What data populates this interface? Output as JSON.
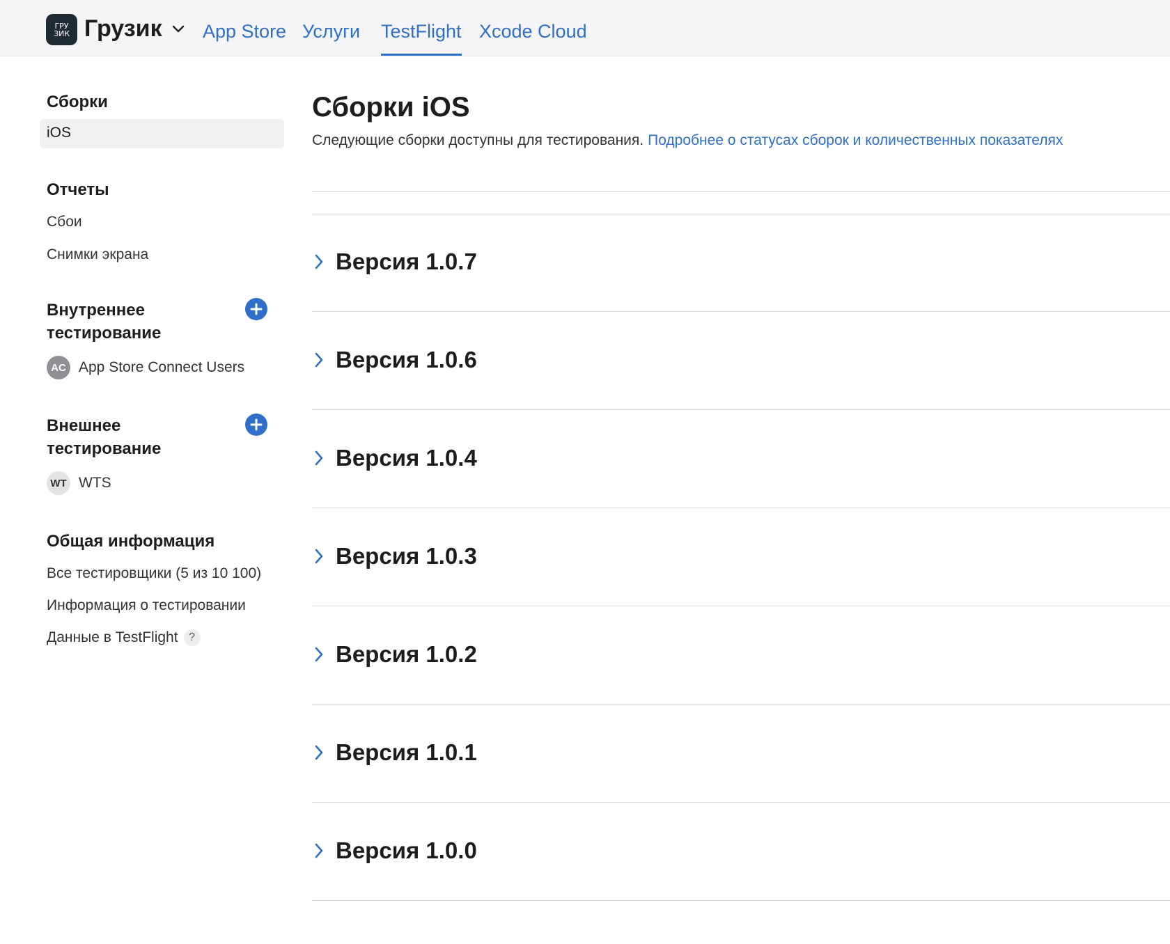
{
  "topbar": {
    "app_icon_text": "ГРУ-ЗИК",
    "app_name": "Грузик",
    "tabs": [
      {
        "label": "App Store"
      },
      {
        "label": "Услуги"
      },
      {
        "label": "TestFlight",
        "active": true
      },
      {
        "label": "Xcode Cloud"
      }
    ]
  },
  "sidebar": {
    "builds": {
      "heading": "Сборки",
      "items": [
        {
          "label": "iOS",
          "selected": true
        }
      ]
    },
    "reports": {
      "heading": "Отчеты",
      "items": [
        {
          "label": "Сбои"
        },
        {
          "label": "Снимки экрана"
        }
      ]
    },
    "internal": {
      "heading": "Внутреннее тестирование",
      "groups": [
        {
          "initials": "AC",
          "label": "App Store Connect Users"
        }
      ]
    },
    "external": {
      "heading": "Внешнее тестирование",
      "groups": [
        {
          "initials": "WT",
          "label": "WTS"
        }
      ]
    },
    "general": {
      "heading": "Общая информация",
      "items": [
        {
          "label": "Все тестировщики (5 из 10 100)"
        },
        {
          "label": "Информация о тестировании"
        },
        {
          "label": "Данные в TestFlight"
        }
      ],
      "help_icon_text": "?"
    }
  },
  "main": {
    "title": "Сборки iOS",
    "subtitle": "Следующие сборки доступны для тестирования.",
    "subtitle_link": "Подробнее о статусах сборок и количественных показателях",
    "versions": [
      {
        "label": "Версия 1.0.7"
      },
      {
        "label": "Версия 1.0.6"
      },
      {
        "label": "Версия 1.0.4"
      },
      {
        "label": "Версия 1.0.3"
      },
      {
        "label": "Версия 1.0.2"
      },
      {
        "label": "Версия 1.0.1"
      },
      {
        "label": "Версия 1.0.0"
      }
    ]
  },
  "colors": {
    "accent": "#2f6fc9",
    "topbar_bg": "#f5f5f7",
    "selected_bg": "#f0f0f2"
  }
}
